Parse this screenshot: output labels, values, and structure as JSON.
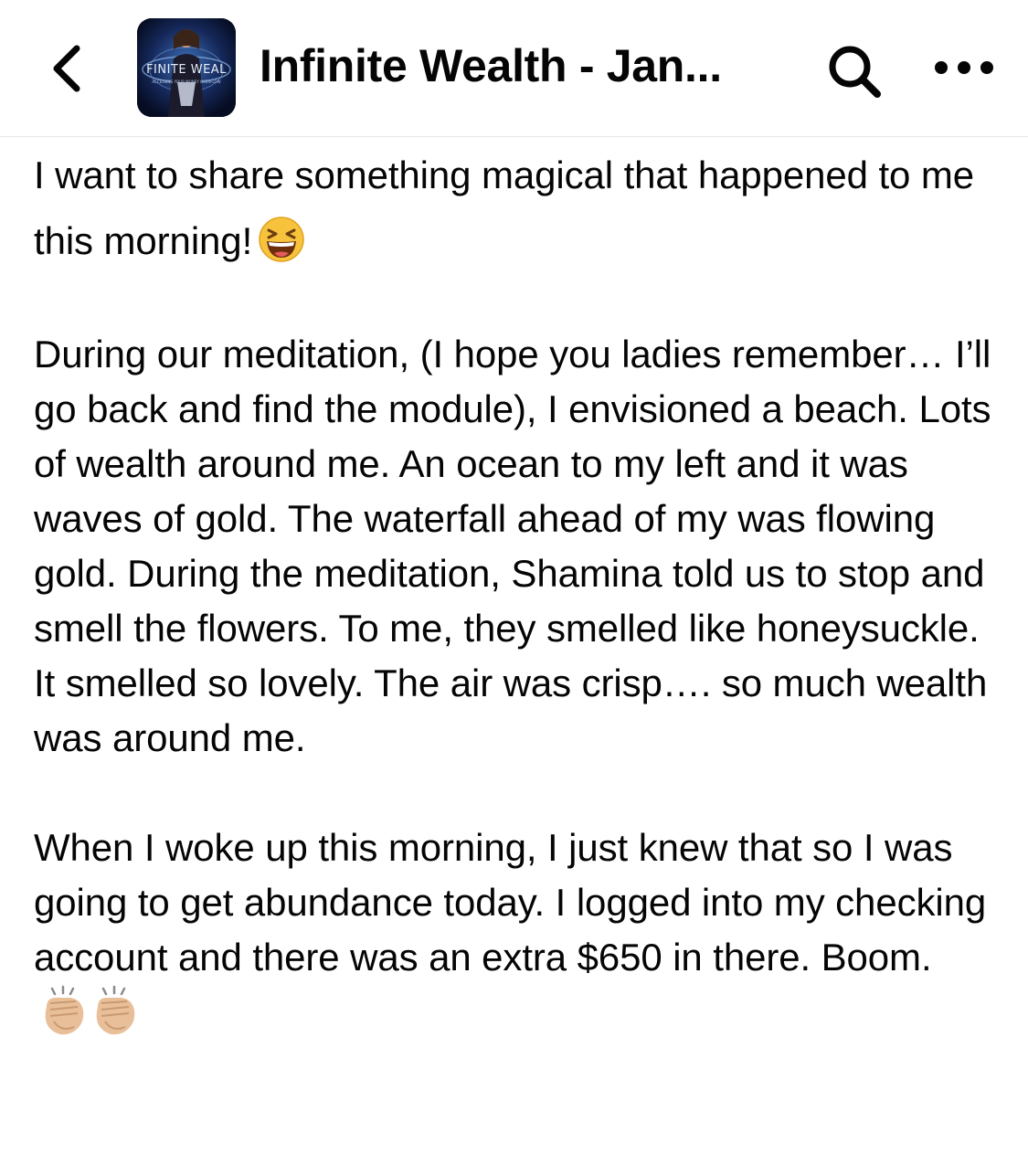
{
  "header": {
    "back_icon": "chevron-left-icon",
    "group_title": "Infinite Wealth - Jan...",
    "group_avatar_text": "FINITE WEAL",
    "search_icon": "search-icon",
    "more_icon": "more-horizontal-icon"
  },
  "post": {
    "paragraph_1": "I want to share something magical that happened to me this morning!",
    "paragraph_1_emoji": "grinning-squinting-face-emoji",
    "paragraph_2": "During our meditation, (I hope you ladies remember… I’ll go back and find the module), I envisioned a beach. Lots of wealth around me. An ocean to my left and it was waves of gold. The waterfall ahead of my was flowing gold. During the meditation, Shamina told us to stop and smell the flowers. To me, they smelled like honeysuckle. It smelled so lovely. The air was crisp…. so much wealth was around me.",
    "paragraph_3": "When I woke up this morning, I just knew that so I was going to get abundance today. I logged into my checking account and there was an extra $650 in there. Boom.",
    "paragraph_3_emoji": "clapping-hands-emoji"
  },
  "colors": {
    "text": "#050505",
    "divider": "#e4e6eb",
    "emoji_face": "#f7c33d",
    "emoji_clap": "#e8bf98"
  }
}
